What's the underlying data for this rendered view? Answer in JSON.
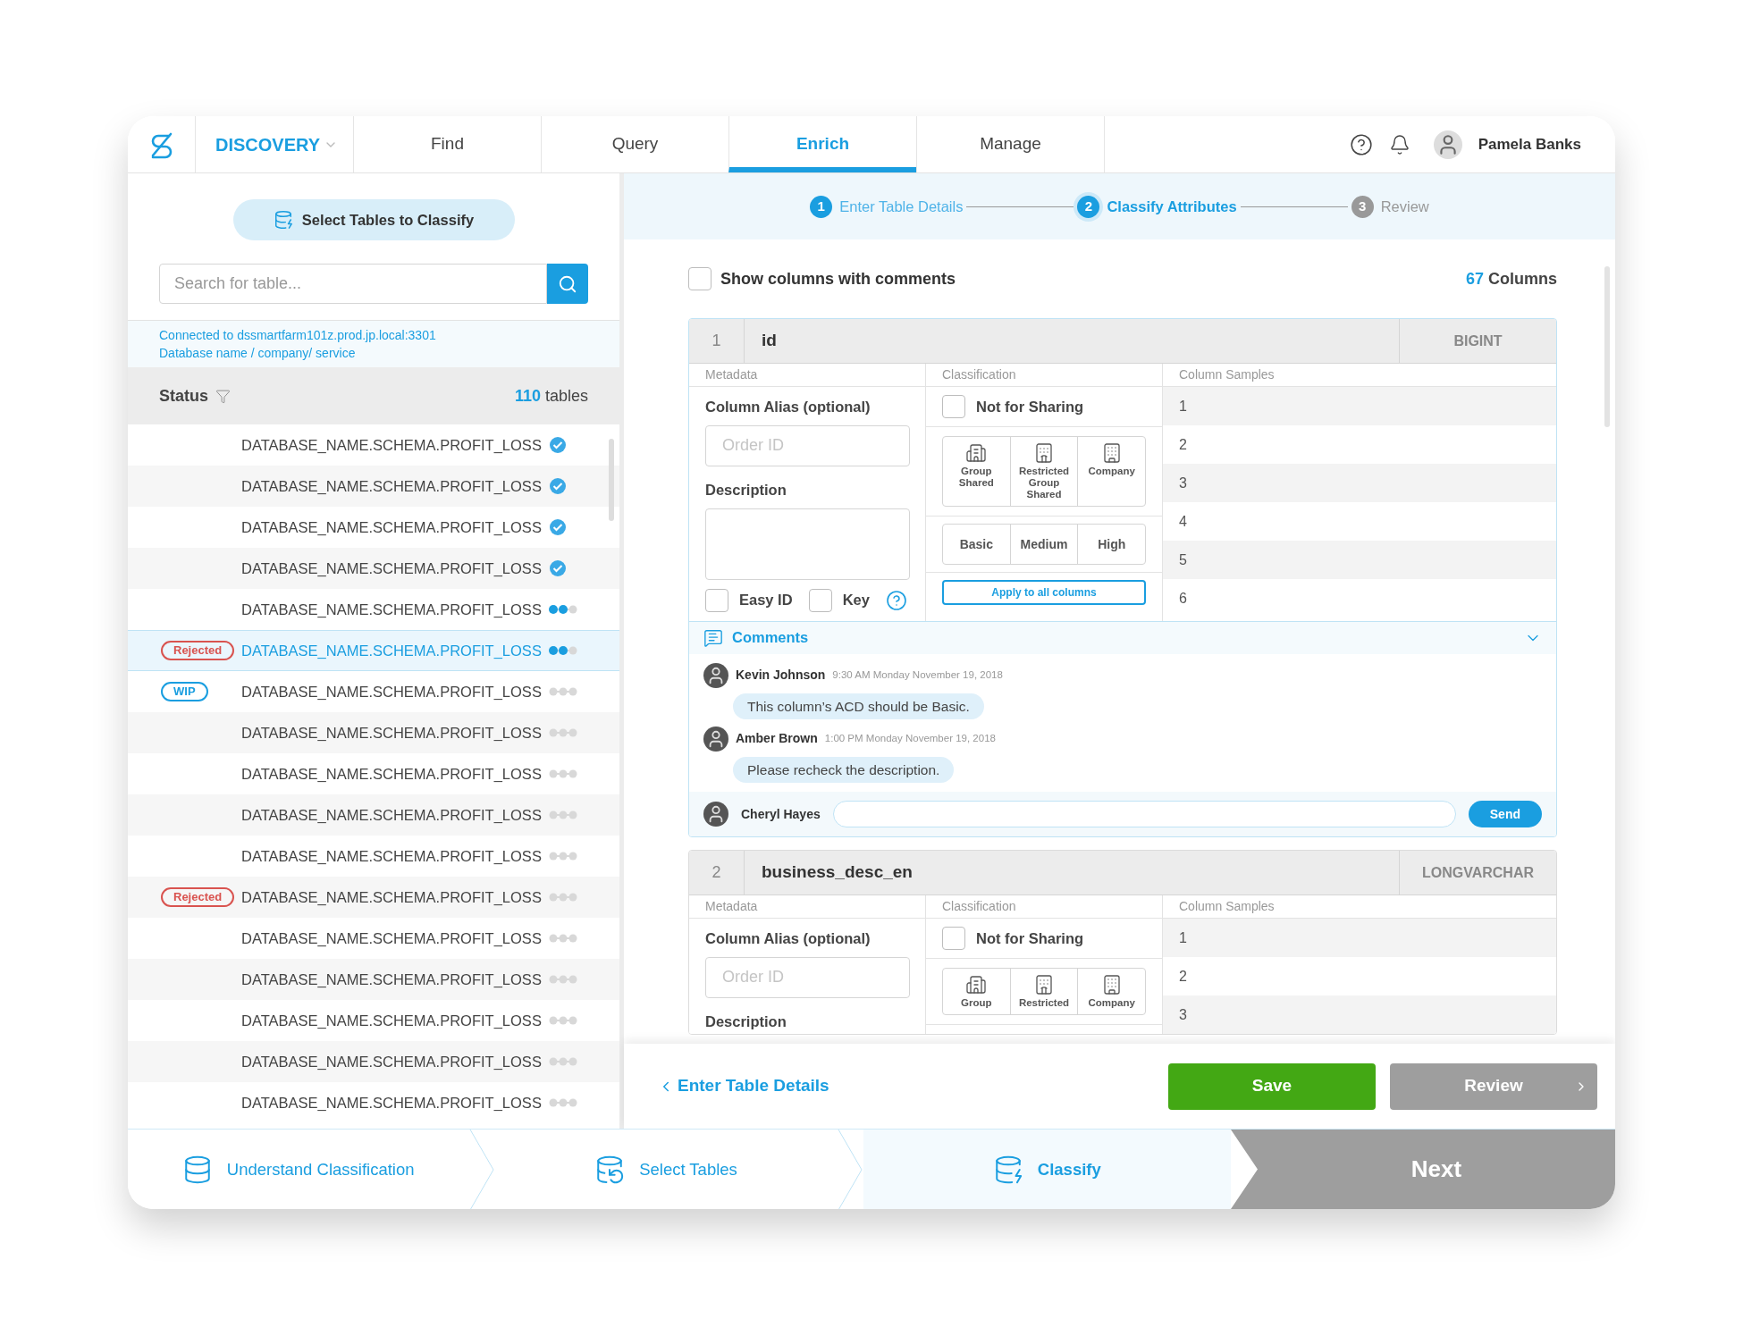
{
  "header": {
    "app_name": "DISCOVERY",
    "tabs": [
      {
        "label": "Find",
        "selected": false
      },
      {
        "label": "Query",
        "selected": false
      },
      {
        "label": "Enrich",
        "selected": true
      },
      {
        "label": "Manage",
        "selected": false
      }
    ],
    "user": {
      "name": "Pamela Banks"
    }
  },
  "left": {
    "select_button": "Select Tables to Classify",
    "search": {
      "placeholder": "Search for table..."
    },
    "connection": [
      "Connected to dssmartfarm101z.prod.jp.local:3301",
      "Database name / company/ service"
    ],
    "status": {
      "label": "Status",
      "count": "110",
      "unit": "tables"
    },
    "tables": [
      {
        "name": "DATABASE_NAME.SCHEMA.PROFIT_LOSS",
        "kind": "check",
        "selected": false
      },
      {
        "name": "DATABASE_NAME.SCHEMA.PROFIT_LOSS",
        "kind": "check",
        "selected": false
      },
      {
        "name": "DATABASE_NAME.SCHEMA.PROFIT_LOSS",
        "kind": "check",
        "selected": false
      },
      {
        "name": "DATABASE_NAME.SCHEMA.PROFIT_LOSS",
        "kind": "check",
        "selected": false
      },
      {
        "name": "DATABASE_NAME.SCHEMA.PROFIT_LOSS",
        "kind": "dots",
        "stars": 2,
        "selected": false
      },
      {
        "name": "DATABASE_NAME.SCHEMA.PROFIT_LOSS",
        "kind": "dots",
        "stars": 2,
        "selected": true,
        "badge": {
          "label": "Rejected",
          "kind": "rejected"
        }
      },
      {
        "name": "DATABASE_NAME.SCHEMA.PROFIT_LOSS",
        "kind": "dots",
        "stars": 0,
        "selected": false,
        "badge": {
          "label": "WIP",
          "kind": "wip"
        }
      },
      {
        "name": "DATABASE_NAME.SCHEMA.PROFIT_LOSS",
        "kind": "dots",
        "stars": 0,
        "selected": false
      },
      {
        "name": "DATABASE_NAME.SCHEMA.PROFIT_LOSS",
        "kind": "dots",
        "stars": 0,
        "selected": false
      },
      {
        "name": "DATABASE_NAME.SCHEMA.PROFIT_LOSS",
        "kind": "dots",
        "stars": 0,
        "selected": false
      },
      {
        "name": "DATABASE_NAME.SCHEMA.PROFIT_LOSS",
        "kind": "dots",
        "stars": 0,
        "selected": false
      },
      {
        "name": "DATABASE_NAME.SCHEMA.PROFIT_LOSS",
        "kind": "dots",
        "stars": 0,
        "selected": false,
        "badge": {
          "label": "Rejected",
          "kind": "rejected"
        }
      },
      {
        "name": "DATABASE_NAME.SCHEMA.PROFIT_LOSS",
        "kind": "dots",
        "stars": 0,
        "selected": false
      },
      {
        "name": "DATABASE_NAME.SCHEMA.PROFIT_LOSS",
        "kind": "dots",
        "stars": 0,
        "selected": false
      },
      {
        "name": "DATABASE_NAME.SCHEMA.PROFIT_LOSS",
        "kind": "dots",
        "stars": 0,
        "selected": false
      },
      {
        "name": "DATABASE_NAME.SCHEMA.PROFIT_LOSS",
        "kind": "dots",
        "stars": 0,
        "selected": false
      },
      {
        "name": "DATABASE_NAME.SCHEMA.PROFIT_LOSS",
        "kind": "dots",
        "stars": 0,
        "selected": false
      }
    ]
  },
  "stepper": [
    {
      "number": "1",
      "label": "Enter Table Details",
      "done": true,
      "selected": false
    },
    {
      "number": "2",
      "label": "Classify Attributes",
      "done": false,
      "selected": true
    },
    {
      "number": "3",
      "label": "Review",
      "done": false,
      "selected": false
    }
  ],
  "show_comments": {
    "label": "Show columns with comments",
    "checked": false
  },
  "columns_count": {
    "count": "67",
    "unit": "Columns"
  },
  "columns": [
    {
      "index": "1",
      "name": "id",
      "type": "BIGINT",
      "sections": [
        "Metadata",
        "Classification",
        "Column Samples"
      ],
      "alias_label": "Column Alias (optional)",
      "alias": {
        "placeholder": "Order ID"
      },
      "description_label": "Description",
      "description_box": true,
      "flags": [
        {
          "label": "Easy ID",
          "checked": false
        },
        {
          "label": "Key",
          "checked": false
        }
      ],
      "not_for_sharing": {
        "label": "Not for Sharing",
        "checked": false
      },
      "sharing_options": [
        {
          "label": "Group Shared",
          "kind": "group",
          "selected": false
        },
        {
          "label": "Restricted Group Shared",
          "kind": "restricted",
          "selected": false
        },
        {
          "label": "Company",
          "kind": "company",
          "selected": false
        }
      ],
      "levels": [
        {
          "label": "Basic",
          "selected": false
        },
        {
          "label": "Medium",
          "selected": false
        },
        {
          "label": "High",
          "selected": false
        }
      ],
      "apply_button": "Apply to all columns",
      "samples": [
        "1",
        "2",
        "3",
        "4",
        "5",
        "6"
      ],
      "comments": {
        "title": "Comments",
        "expanded": true,
        "items": [
          {
            "author": "Kevin Johnson",
            "time": "9:30 AM Monday November 19, 2018",
            "text": "This column’s ACD should be Basic."
          },
          {
            "author": "Amber Brown",
            "time": "1:00 PM Monday November 19, 2018",
            "text": "Please recheck the description."
          }
        ],
        "composer": {
          "user": "Cheryl Hayes",
          "button": "Send"
        }
      }
    },
    {
      "index": "2",
      "name": "business_desc_en",
      "type": "LONGVARCHAR",
      "sections": [
        "Metadata",
        "Classification",
        "Column Samples"
      ],
      "alias_label": "Column Alias (optional)",
      "alias": {
        "placeholder": "Order ID"
      },
      "description_label": "Description",
      "description_box": false,
      "not_for_sharing": {
        "label": "Not for Sharing",
        "checked": false
      },
      "sharing_options": [
        {
          "label": "Group",
          "kind": "group",
          "selected": false
        },
        {
          "label": "Restricted",
          "kind": "restricted",
          "selected": false
        },
        {
          "label": "Company",
          "kind": "company",
          "selected": false
        }
      ],
      "samples": [
        "1",
        "2",
        "3"
      ]
    }
  ],
  "actions": {
    "back": "Enter Table Details",
    "save": "Save",
    "review": "Review"
  },
  "wizard": {
    "steps": [
      {
        "label": "Understand Classification",
        "kind": "understand",
        "selected": false
      },
      {
        "label": "Select Tables",
        "kind": "select",
        "selected": false
      },
      {
        "label": "Classify",
        "kind": "classify",
        "selected": true
      }
    ],
    "next": "Next"
  }
}
